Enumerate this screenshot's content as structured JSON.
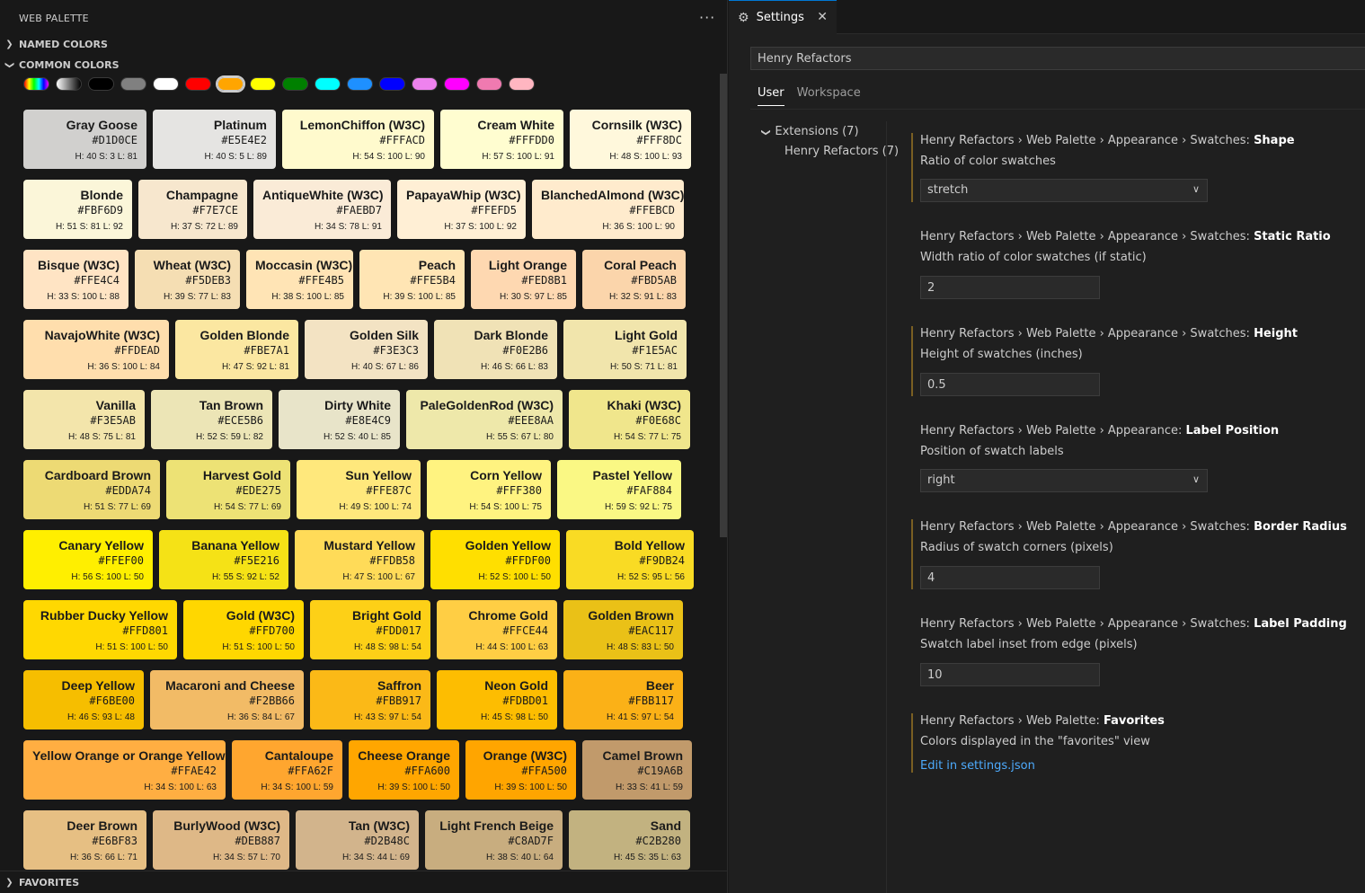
{
  "sidebar": {
    "title": "WEB PALETTE",
    "more": "···",
    "sections": {
      "named": "NAMED COLORS",
      "common": "COMMON COLORS",
      "favorites": "FAVORITES"
    },
    "filters": [
      {
        "name": "rainbow",
        "bg": "linear-gradient(90deg,#ff0000,#ffff00,#00ff00,#00ffff,#0000ff,#ff00ff)"
      },
      {
        "name": "grayscale",
        "bg": "linear-gradient(90deg,#ffffff,#000000)"
      },
      {
        "name": "black",
        "bg": "#000000"
      },
      {
        "name": "gray",
        "bg": "#808080"
      },
      {
        "name": "white",
        "bg": "#ffffff"
      },
      {
        "name": "red",
        "bg": "#ff0000"
      },
      {
        "name": "orange",
        "bg": "#ffa500",
        "selected": true
      },
      {
        "name": "yellow",
        "bg": "#ffff00"
      },
      {
        "name": "green",
        "bg": "#008000"
      },
      {
        "name": "cyan",
        "bg": "#00ffff"
      },
      {
        "name": "sky-blue",
        "bg": "#1e90ff"
      },
      {
        "name": "blue",
        "bg": "#0000ff"
      },
      {
        "name": "violet",
        "bg": "#ee82ee"
      },
      {
        "name": "magenta",
        "bg": "#ff00ff"
      },
      {
        "name": "pink",
        "bg": "#f07ab0"
      },
      {
        "name": "light-pink",
        "bg": "#ffb6c1"
      }
    ],
    "rows": [
      [
        {
          "name": "Gray Goose",
          "hex": "#D1D0CE",
          "hsl": "H: 40 S: 3 L: 81",
          "w": 137
        },
        {
          "name": "Platinum",
          "hex": "#E5E4E2",
          "hsl": "H: 40 S: 5 L: 89",
          "w": 137
        },
        {
          "name": "LemonChiffon (W3C)",
          "hex": "#FFFACD",
          "hsl": "H: 54 S: 100 L: 90",
          "w": 169
        },
        {
          "name": "Cream White",
          "hex": "#FFFDD0",
          "hsl": "H: 57 S: 100 L: 91",
          "w": 137
        },
        {
          "name": "Cornsilk (W3C)",
          "hex": "#FFF8DC",
          "hsl": "H: 48 S: 100 L: 93",
          "w": 135
        }
      ],
      [
        {
          "name": "Blonde",
          "hex": "#FBF6D9",
          "hsl": "H: 51 S: 81 L: 92",
          "w": 121
        },
        {
          "name": "Champagne",
          "hex": "#F7E7CE",
          "hsl": "H: 37 S: 72 L: 89",
          "w": 121
        },
        {
          "name": "AntiqueWhite (W3C)",
          "hex": "#FAEBD7",
          "hsl": "H: 34 S: 78 L: 91",
          "w": 153
        },
        {
          "name": "PapayaWhip (W3C)",
          "hex": "#FFEFD5",
          "hsl": "H: 37 S: 100 L: 92",
          "w": 143
        },
        {
          "name": "BlanchedAlmond (W3C)",
          "hex": "#FFEBCD",
          "hsl": "H: 36 S: 100 L: 90",
          "w": 169
        }
      ],
      [
        {
          "name": "Bisque (W3C)",
          "hex": "#FFE4C4",
          "hsl": "H: 33 S: 100 L: 88",
          "w": 117
        },
        {
          "name": "Wheat (W3C)",
          "hex": "#F5DEB3",
          "hsl": "H: 39 S: 77 L: 83",
          "w": 117
        },
        {
          "name": "Moccasin (W3C)",
          "hex": "#FFE4B5",
          "hsl": "H: 38 S: 100 L: 85",
          "w": 119
        },
        {
          "name": "Peach",
          "hex": "#FFE5B4",
          "hsl": "H: 39 S: 100 L: 85",
          "w": 117
        },
        {
          "name": "Light Orange",
          "hex": "#FED8B1",
          "hsl": "H: 30 S: 97 L: 85",
          "w": 117
        },
        {
          "name": "Coral Peach",
          "hex": "#FBD5AB",
          "hsl": "H: 32 S: 91 L: 83",
          "w": 115
        }
      ],
      [
        {
          "name": "NavajoWhite (W3C)",
          "hex": "#FFDEAD",
          "hsl": "H: 36 S: 100 L: 84",
          "w": 162
        },
        {
          "name": "Golden Blonde",
          "hex": "#FBE7A1",
          "hsl": "H: 47 S: 92 L: 81",
          "w": 137
        },
        {
          "name": "Golden Silk",
          "hex": "#F3E3C3",
          "hsl": "H: 40 S: 67 L: 86",
          "w": 137
        },
        {
          "name": "Dark Blonde",
          "hex": "#F0E2B6",
          "hsl": "H: 46 S: 66 L: 83",
          "w": 137
        },
        {
          "name": "Light Gold",
          "hex": "#F1E5AC",
          "hsl": "H: 50 S: 71 L: 81",
          "w": 137
        }
      ],
      [
        {
          "name": "Vanilla",
          "hex": "#F3E5AB",
          "hsl": "H: 48 S: 75 L: 81",
          "w": 135
        },
        {
          "name": "Tan Brown",
          "hex": "#ECE5B6",
          "hsl": "H: 52 S: 59 L: 82",
          "w": 135
        },
        {
          "name": "Dirty White",
          "hex": "#E8E4C9",
          "hsl": "H: 52 S: 40 L: 85",
          "w": 135
        },
        {
          "name": "PaleGoldenRod (W3C)",
          "hex": "#EEE8AA",
          "hsl": "H: 55 S: 67 L: 80",
          "w": 174
        },
        {
          "name": "Khaki (W3C)",
          "hex": "#F0E68C",
          "hsl": "H: 54 S: 77 L: 75",
          "w": 135
        }
      ],
      [
        {
          "name": "Cardboard Brown",
          "hex": "#EDDA74",
          "hsl": "H: 51 S: 77 L: 69",
          "w": 152
        },
        {
          "name": "Harvest Gold",
          "hex": "#EDE275",
          "hsl": "H: 54 S: 77 L: 69",
          "w": 138
        },
        {
          "name": "Sun Yellow",
          "hex": "#FFE87C",
          "hsl": "H: 49 S: 100 L: 74",
          "w": 138
        },
        {
          "name": "Corn Yellow",
          "hex": "#FFF380",
          "hsl": "H: 54 S: 100 L: 75",
          "w": 138
        },
        {
          "name": "Pastel Yellow",
          "hex": "#FAF884",
          "hsl": "H: 59 S: 92 L: 75",
          "w": 138
        }
      ],
      [
        {
          "name": "Canary Yellow",
          "hex": "#FFEF00",
          "hsl": "H: 56 S: 100 L: 50",
          "w": 144
        },
        {
          "name": "Banana Yellow",
          "hex": "#F5E216",
          "hsl": "H: 55 S: 92 L: 52",
          "w": 144
        },
        {
          "name": "Mustard Yellow",
          "hex": "#FFDB58",
          "hsl": "H: 47 S: 100 L: 67",
          "w": 144
        },
        {
          "name": "Golden Yellow",
          "hex": "#FFDF00",
          "hsl": "H: 52 S: 100 L: 50",
          "w": 144
        },
        {
          "name": "Bold Yellow",
          "hex": "#F9DB24",
          "hsl": "H: 52 S: 95 L: 56",
          "w": 142
        }
      ],
      [
        {
          "name": "Rubber Ducky Yellow",
          "hex": "#FFD801",
          "hsl": "H: 51 S: 100 L: 50",
          "w": 171
        },
        {
          "name": "Gold (W3C)",
          "hex": "#FFD700",
          "hsl": "H: 51 S: 100 L: 50",
          "w": 134
        },
        {
          "name": "Bright Gold",
          "hex": "#FDD017",
          "hsl": "H: 48 S: 98 L: 54",
          "w": 134
        },
        {
          "name": "Chrome Gold",
          "hex": "#FFCE44",
          "hsl": "H: 44 S: 100 L: 63",
          "w": 134
        },
        {
          "name": "Golden Brown",
          "hex": "#EAC117",
          "hsl": "H: 48 S: 83 L: 50",
          "w": 133
        }
      ],
      [
        {
          "name": "Deep Yellow",
          "hex": "#F6BE00",
          "hsl": "H: 46 S: 93 L: 48",
          "w": 134
        },
        {
          "name": "Macaroni and Cheese",
          "hex": "#F2BB66",
          "hsl": "H: 36 S: 84 L: 67",
          "w": 171
        },
        {
          "name": "Saffron",
          "hex": "#FBB917",
          "hsl": "H: 43 S: 97 L: 54",
          "w": 134
        },
        {
          "name": "Neon Gold",
          "hex": "#FDBD01",
          "hsl": "H: 45 S: 98 L: 50",
          "w": 134
        },
        {
          "name": "Beer",
          "hex": "#FBB117",
          "hsl": "H: 41 S: 97 L: 54",
          "w": 133
        }
      ],
      [
        {
          "name": "Yellow Orange or Orange Yellow",
          "hex": "#FFAE42",
          "hsl": "H: 34 S: 100 L: 63",
          "w": 225
        },
        {
          "name": "Cantaloupe",
          "hex": "#FFA62F",
          "hsl": "H: 34 S: 100 L: 59",
          "w": 123
        },
        {
          "name": "Cheese Orange",
          "hex": "#FFA600",
          "hsl": "H: 39 S: 100 L: 50",
          "w": 123
        },
        {
          "name": "Orange (W3C)",
          "hex": "#FFA500",
          "hsl": "H: 39 S: 100 L: 50",
          "w": 123
        },
        {
          "name": "Camel Brown",
          "hex": "#C19A6B",
          "hsl": "H: 33 S: 41 L: 59",
          "w": 122
        }
      ],
      [
        {
          "name": "Deer Brown",
          "hex": "#E6BF83",
          "hsl": "H: 36 S: 66 L: 71",
          "w": 137
        },
        {
          "name": "BurlyWood (W3C)",
          "hex": "#DEB887",
          "hsl": "H: 34 S: 57 L: 70",
          "w": 152
        },
        {
          "name": "Tan (W3C)",
          "hex": "#D2B48C",
          "hsl": "H: 34 S: 44 L: 69",
          "w": 137
        },
        {
          "name": "Light French Beige",
          "hex": "#C8AD7F",
          "hsl": "H: 38 S: 40 L: 64",
          "w": 153
        },
        {
          "name": "Sand",
          "hex": "#C2B280",
          "hsl": "H: 45 S: 35 L: 63",
          "w": 135
        }
      ]
    ]
  },
  "editor": {
    "tab_label": "Settings",
    "search_value": "Henry Refactors",
    "scopes": [
      "User",
      "Workspace"
    ],
    "toc": {
      "extensions": "Extensions (7)",
      "henry": "Henry Refactors (7)"
    },
    "settings": [
      {
        "prefix": "Henry Refactors › Web Palette › Appearance › Swatches: ",
        "key": "Shape",
        "desc": "Ratio of color swatches",
        "kind": "select",
        "value": "stretch",
        "modified": true
      },
      {
        "prefix": "Henry Refactors › Web Palette › Appearance › Swatches: ",
        "key": "Static Ratio",
        "desc": "Width ratio of color swatches (if static)",
        "kind": "input",
        "value": "2",
        "modified": false
      },
      {
        "prefix": "Henry Refactors › Web Palette › Appearance › Swatches: ",
        "key": "Height",
        "desc": "Height of swatches (inches)",
        "kind": "input",
        "value": "0.5",
        "modified": true
      },
      {
        "prefix": "Henry Refactors › Web Palette › Appearance: ",
        "key": "Label Position",
        "desc": "Position of swatch labels",
        "kind": "select",
        "value": "right",
        "modified": false
      },
      {
        "prefix": "Henry Refactors › Web Palette › Appearance › Swatches: ",
        "key": "Border Radius",
        "desc": "Radius of swatch corners (pixels)",
        "kind": "input",
        "value": "4",
        "modified": true
      },
      {
        "prefix": "Henry Refactors › Web Palette › Appearance › Swatches: ",
        "key": "Label Padding",
        "desc": "Swatch label inset from edge (pixels)",
        "kind": "input",
        "value": "10",
        "modified": false
      },
      {
        "prefix": "Henry Refactors › Web Palette: ",
        "key": "Favorites",
        "desc": "Colors displayed in the \"favorites\" view",
        "kind": "link",
        "value": "Edit in settings.json",
        "modified": true
      }
    ]
  }
}
